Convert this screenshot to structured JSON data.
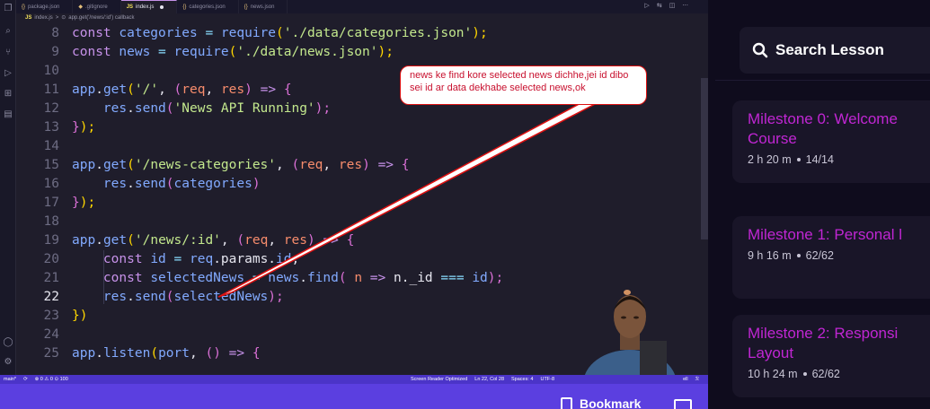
{
  "editor": {
    "tabs": [
      {
        "icon": "{}",
        "label": "package.json",
        "active": false
      },
      {
        "icon": "",
        "label": ".gitignore",
        "active": false
      },
      {
        "icon": "JS",
        "label": "index.js",
        "active": true
      },
      {
        "icon": "{}",
        "label": "categories.json",
        "active": false
      },
      {
        "icon": "{}",
        "label": "news.json",
        "active": false
      }
    ],
    "actions": [
      "▷",
      "⇆",
      "◫",
      "···"
    ],
    "breadcrumb": {
      "file_icon": "JS",
      "file": "index.js",
      "sep": ">",
      "symbol_icon": "⊙",
      "symbol": "app.get('/news/:id') callback"
    },
    "lines": [
      {
        "n": "8"
      },
      {
        "n": "9"
      },
      {
        "n": "10"
      },
      {
        "n": "11"
      },
      {
        "n": "12"
      },
      {
        "n": "13"
      },
      {
        "n": "14"
      },
      {
        "n": "15"
      },
      {
        "n": "16"
      },
      {
        "n": "17"
      },
      {
        "n": "18"
      },
      {
        "n": "19"
      },
      {
        "n": "20"
      },
      {
        "n": "21"
      },
      {
        "n": "22"
      },
      {
        "n": "23"
      },
      {
        "n": "24"
      },
      {
        "n": "25"
      }
    ],
    "code": {
      "l8": [
        "const",
        "categories",
        "=",
        "require",
        "(",
        "'./data/categories.json'",
        ");"
      ],
      "l9": [
        "const",
        "news",
        "=",
        "require",
        "(",
        "'./data/news.json'",
        ");"
      ],
      "l11": [
        "app",
        ".",
        "get",
        "(",
        "'/'",
        ",",
        "(",
        "req",
        ",",
        "res",
        ")",
        "=>",
        "{"
      ],
      "l12": [
        "res",
        ".",
        "send",
        "(",
        "'News API Running'",
        ");"
      ],
      "l13": [
        "}",
        ");"
      ],
      "l15": [
        "app",
        ".",
        "get",
        "(",
        "'/news-categories'",
        ",",
        "(",
        "req",
        ",",
        "res",
        ")",
        "=>",
        "{"
      ],
      "l16": [
        "res",
        ".",
        "send",
        "(",
        "categories",
        ")"
      ],
      "l17": [
        "}",
        ");"
      ],
      "l19": [
        "app",
        ".",
        "get",
        "(",
        "'/news/:id'",
        ",",
        "(",
        "req",
        ",",
        "res",
        ")",
        "=>",
        "{"
      ],
      "l20": [
        "const",
        "id",
        "=",
        "req",
        ".params.",
        "id",
        ";"
      ],
      "l21": [
        "const",
        "selectedNews",
        "=",
        "news",
        ".",
        "find",
        "(",
        "n",
        "=>",
        "n._id",
        "===",
        "id",
        ");"
      ],
      "l22": [
        "res",
        ".",
        "send",
        "(",
        "selectedNews",
        ");"
      ],
      "l23": [
        "})"
      ],
      "l25": [
        "app",
        ".",
        "listen",
        "(",
        "port",
        ",",
        "(",
        ")",
        "=>",
        "{"
      ]
    },
    "annotation": "news ke find kore selected news dichhe,jei id dibo sei id ar data dekhabe selected news,ok",
    "status": {
      "branch": "main*",
      "sync": "⟳",
      "problems": "⊗ 0 ⚠ 0 ⊙ 100",
      "screen_reader": "Screen Reader Optimized",
      "position": "Ln 22, Col 28",
      "spaces": "Spaces: 4",
      "encoding": "UTF-8",
      "shell": "ell",
      "bell": "ℛ"
    }
  },
  "player": {
    "bookmark_label": "Bookmark"
  },
  "sidebar": {
    "search_label": "Search Lesson",
    "milestones": [
      {
        "title": "Milestone 0: Welcome\nCourse",
        "duration": "2 h 20 m",
        "progress": "14/14"
      },
      {
        "title": "Milestone 1: Personal l",
        "duration": "9 h 16 m",
        "progress": "62/62"
      },
      {
        "title": "Milestone 2: Responsi\nLayout",
        "duration": "10 h 24 m",
        "progress": "62/62"
      }
    ]
  },
  "colors": {
    "accent": "#5b3fe0",
    "milestone_title": "#c026d3",
    "annotation_red": "#d11"
  }
}
